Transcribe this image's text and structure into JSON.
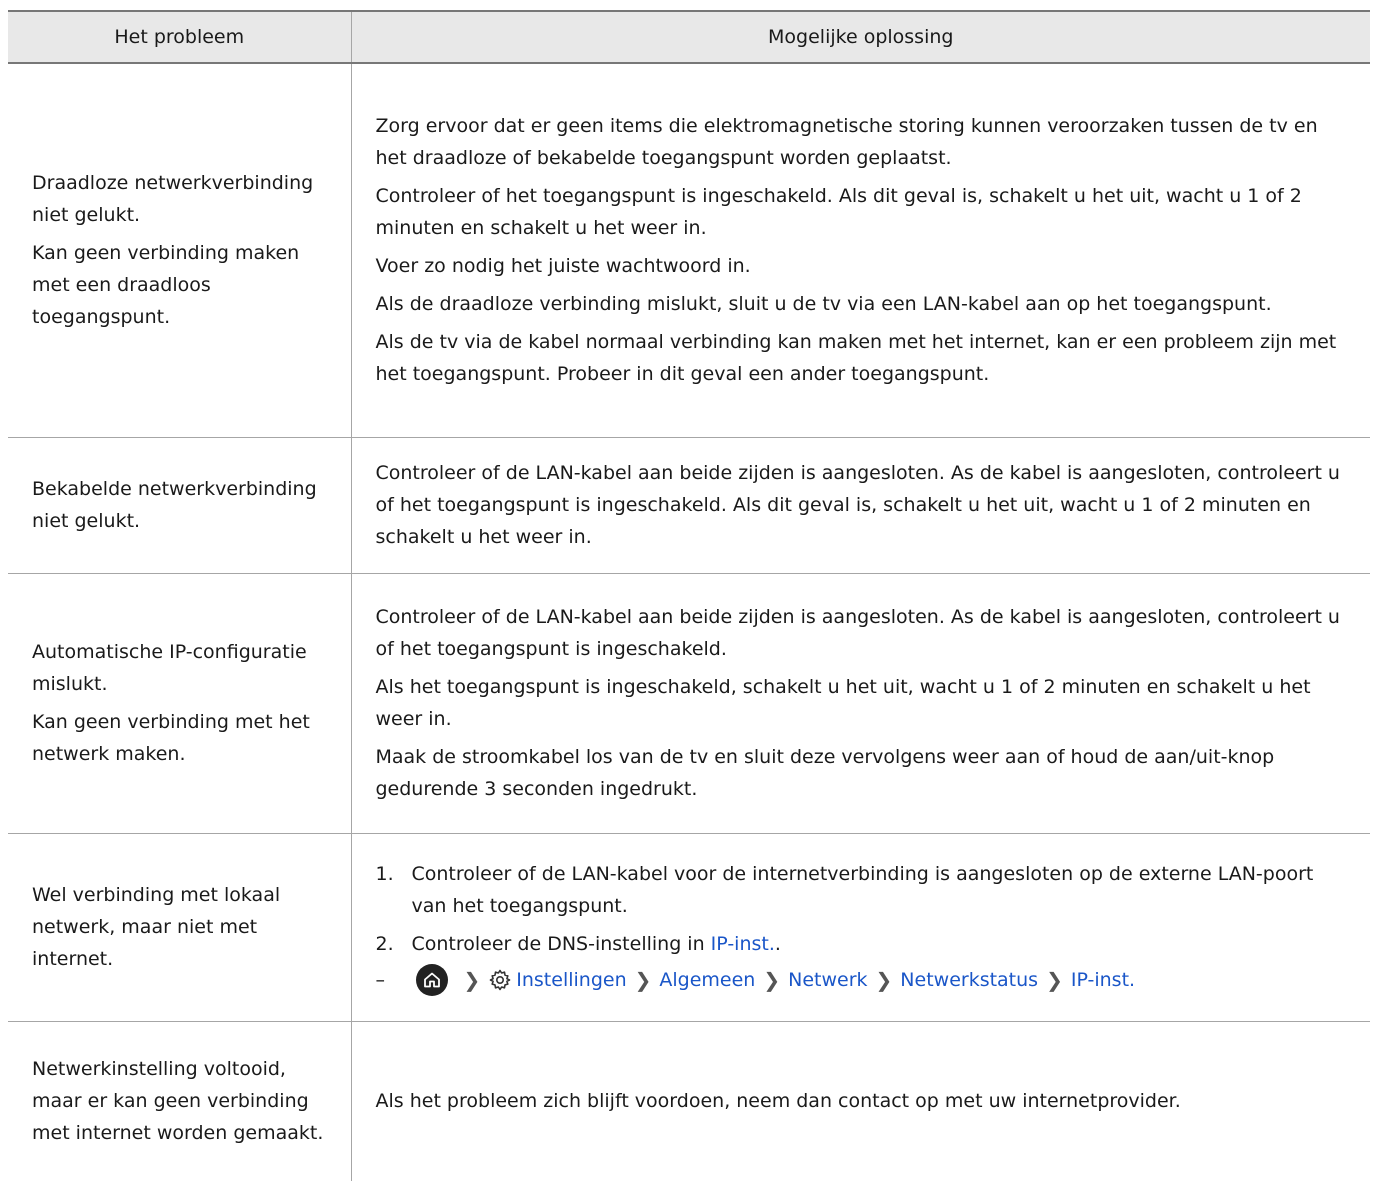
{
  "header": {
    "col_problem": "Het probleem",
    "col_solution": "Mogelijke oplossing"
  },
  "rows": [
    {
      "problem": [
        "Draadloze netwerkverbinding niet gelukt.",
        "Kan geen verbinding maken met een draadloos toegangspunt."
      ],
      "solution": [
        "Zorg ervoor dat er geen items die elektromagnetische storing kunnen veroorzaken tussen de tv en het draadloze of bekabelde toegangspunt worden geplaatst.",
        "Controleer of het toegangspunt is ingeschakeld. Als dit geval is, schakelt u het uit, wacht u 1 of 2 minuten en schakelt u het weer in.",
        "Voer zo nodig het juiste wachtwoord in.",
        "Als de draadloze verbinding mislukt, sluit u de tv via een LAN-kabel aan op het toegangspunt.",
        "Als de tv via de kabel normaal verbinding kan maken met het internet, kan er een probleem zijn met het toegangspunt. Probeer in dit geval een ander toegangspunt."
      ]
    },
    {
      "problem": [
        "Bekabelde netwerkverbinding niet gelukt."
      ],
      "solution": [
        "Controleer of de LAN-kabel aan beide zijden is aangesloten. As de kabel is aangesloten, controleert u of het toegangspunt is ingeschakeld. Als dit geval is, schakelt u het uit, wacht u 1 of 2 minuten en schakelt u het weer in."
      ]
    },
    {
      "problem": [
        "Automatische IP-configuratie mislukt.",
        "Kan geen verbinding met het netwerk maken."
      ],
      "solution": [
        "Controleer of de LAN-kabel aan beide zijden is aangesloten. As de kabel is aangesloten, controleert u of het toegangspunt is ingeschakeld.",
        "Als het toegangspunt is ingeschakeld, schakelt u het uit, wacht u 1 of 2 minuten en schakelt u het weer in.",
        "Maak de stroomkabel los van de tv en sluit deze vervolgens weer aan of houd de aan/uit-knop gedurende 3 seconden ingedrukt."
      ]
    },
    {
      "problem": [
        "Wel verbinding met lokaal netwerk, maar niet met internet."
      ],
      "steps": [
        {
          "num": "1.",
          "text": "Controleer of de LAN-kabel voor de internetverbinding is aangesloten op de externe LAN-poort van het toegangspunt."
        },
        {
          "num": "2.",
          "text": "Controleer de DNS-instelling in ",
          "link": "IP-inst.",
          "tail": "."
        }
      ],
      "menu_path": {
        "dash": "–",
        "home_icon": "home-icon",
        "gear_icon": "gear-icon",
        "items": [
          "Instellingen",
          "Algemeen",
          "Netwerk",
          "Netwerkstatus",
          "IP-inst."
        ]
      }
    },
    {
      "problem": [
        "Netwerkinstelling voltooid, maar er kan geen verbinding met internet worden gemaakt."
      ],
      "solution": [
        "Als het probleem zich blijft voordoen, neem dan contact op met uw internetprovider."
      ]
    }
  ],
  "colors": {
    "header_bg": "#e8e8e8",
    "link": "#1a56c8",
    "rule": "#a6a6a6"
  }
}
